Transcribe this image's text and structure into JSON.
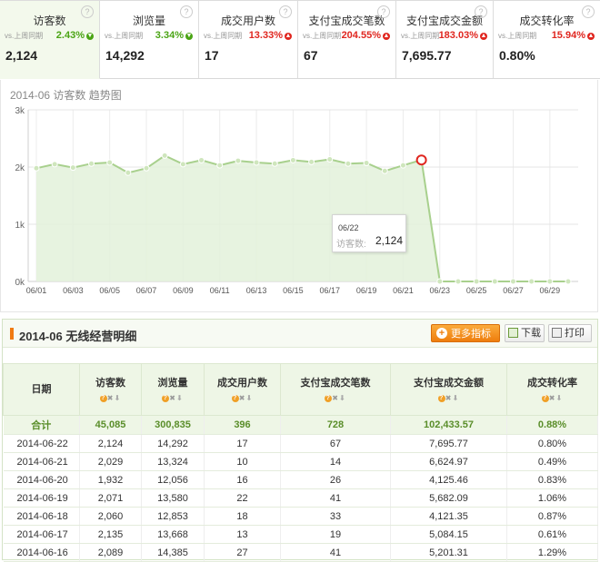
{
  "metrics": [
    {
      "name": "访客数",
      "compare": "vs.上周同期",
      "change": "2.43%",
      "direction": "down",
      "value": "2,124",
      "active": true
    },
    {
      "name": "浏览量",
      "compare": "vs.上周同期",
      "change": "3.34%",
      "direction": "down",
      "value": "14,292"
    },
    {
      "name": "成交用户数",
      "compare": "vs.上周同期",
      "change": "13.33%",
      "direction": "up",
      "value": "17"
    },
    {
      "name": "支付宝成交笔数",
      "compare": "vs.上周同期",
      "change": "204.55%",
      "direction": "up",
      "value": "67"
    },
    {
      "name": "支付宝成交金额",
      "compare": "vs.上周同期",
      "change": "183.03%",
      "direction": "up",
      "value": "7,695.77"
    },
    {
      "name": "成交转化率",
      "compare": "vs.上周同期",
      "change": "15.94%",
      "direction": "up",
      "value": "0.80%"
    }
  ],
  "help_glyph": "?",
  "chart_title": "2014-06 访客数 趋势图",
  "chart_data": {
    "type": "area",
    "title": "2014-06 访客数 趋势图",
    "x": [
      "06/01",
      "06/02",
      "06/03",
      "06/04",
      "06/05",
      "06/06",
      "06/07",
      "06/08",
      "06/09",
      "06/10",
      "06/11",
      "06/12",
      "06/13",
      "06/14",
      "06/15",
      "06/16",
      "06/17",
      "06/18",
      "06/19",
      "06/20",
      "06/21",
      "06/22",
      "06/23",
      "06/24",
      "06/25",
      "06/26",
      "06/27",
      "06/28",
      "06/29",
      "06/30"
    ],
    "x_tick_labels": [
      "06/01",
      "06/03",
      "06/05",
      "06/07",
      "06/09",
      "06/11",
      "06/13",
      "06/15",
      "06/17",
      "06/19",
      "06/21",
      "06/23",
      "06/25",
      "06/27",
      "06/29"
    ],
    "y_tick_labels": [
      "0k",
      "1k",
      "2k",
      "3k"
    ],
    "ylim": [
      0,
      3000
    ],
    "series": [
      {
        "values": [
          1980,
          2050,
          1990,
          2060,
          2080,
          1900,
          1980,
          2200,
          2050,
          2120,
          2030,
          2110,
          2080,
          2060,
          2120,
          2089,
          2135,
          2060,
          2071,
          1932,
          2029,
          2124,
          0,
          0,
          0,
          0,
          0,
          0,
          0,
          0
        ]
      }
    ],
    "grid": true,
    "colors": {
      "line": "#a8d08d",
      "fill": "#e3f1da",
      "highlight": "#e0261f"
    }
  },
  "tooltip": {
    "date": "06/22",
    "label": "访客数:",
    "value": "2,124"
  },
  "panel": {
    "title": "2014-06 无线经营明细",
    "more_button": "更多指标",
    "download_button": "下载",
    "print_button": "打印"
  },
  "table": {
    "headers": [
      "日期",
      "访客数",
      "浏览量",
      "成交用户数",
      "支付宝成交笔数",
      "支付宝成交金额",
      "成交转化率"
    ],
    "summary": [
      "合计",
      "45,085",
      "300,835",
      "396",
      "728",
      "102,433.57",
      "0.88%"
    ],
    "rows": [
      [
        "2014-06-22",
        "2,124",
        "14,292",
        "17",
        "67",
        "7,695.77",
        "0.80%"
      ],
      [
        "2014-06-21",
        "2,029",
        "13,324",
        "10",
        "14",
        "6,624.97",
        "0.49%"
      ],
      [
        "2014-06-20",
        "1,932",
        "12,056",
        "16",
        "26",
        "4,125.46",
        "0.83%"
      ],
      [
        "2014-06-19",
        "2,071",
        "13,580",
        "22",
        "41",
        "5,682.09",
        "1.06%"
      ],
      [
        "2014-06-18",
        "2,060",
        "12,853",
        "18",
        "33",
        "4,121.35",
        "0.87%"
      ],
      [
        "2014-06-17",
        "2,135",
        "13,668",
        "13",
        "19",
        "5,084.15",
        "0.61%"
      ],
      [
        "2014-06-16",
        "2,089",
        "14,385",
        "27",
        "41",
        "5,201.31",
        "1.29%"
      ]
    ]
  }
}
